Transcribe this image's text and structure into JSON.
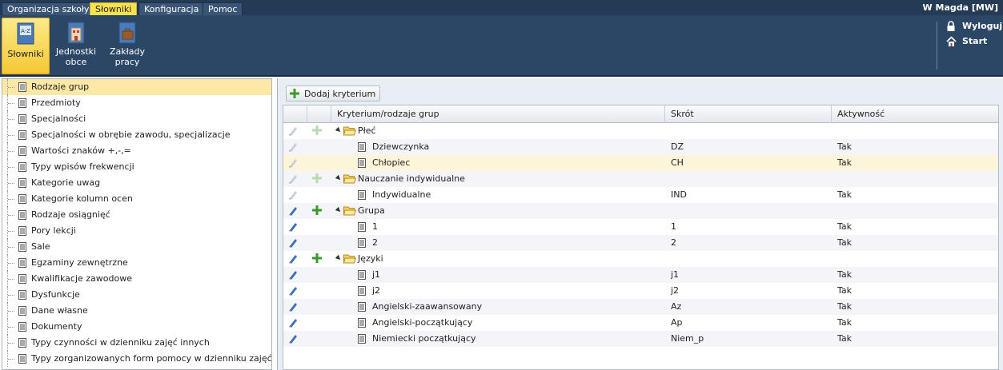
{
  "menu": {
    "tabs": [
      {
        "label": "Organizacja szkoły"
      },
      {
        "label": "Słowniki"
      },
      {
        "label": "Konfiguracja"
      },
      {
        "label": "Pomoc"
      }
    ],
    "user": "W Magda [MW]"
  },
  "ribbon": {
    "buttons": [
      {
        "label": "Słowniki"
      },
      {
        "label": "Jednostki obce"
      },
      {
        "label": "Zakłady pracy"
      }
    ],
    "logout": "Wyloguj",
    "start": "Start"
  },
  "tree": {
    "items": [
      {
        "label": "Rodzaje grup"
      },
      {
        "label": "Przedmioty"
      },
      {
        "label": "Specjalności"
      },
      {
        "label": "Specjalności w obrębie zawodu, specjalizacje"
      },
      {
        "label": "Wartości znaków +,-,="
      },
      {
        "label": "Typy wpisów frekwencji"
      },
      {
        "label": "Kategorie uwag"
      },
      {
        "label": "Kategorie kolumn ocen"
      },
      {
        "label": "Rodzaje osiągnięć"
      },
      {
        "label": "Pory lekcji"
      },
      {
        "label": "Sale"
      },
      {
        "label": "Egzaminy zewnętrzne"
      },
      {
        "label": "Kwalifikacje zawodowe"
      },
      {
        "label": "Dysfunkcje"
      },
      {
        "label": "Dane własne"
      },
      {
        "label": "Dokumenty"
      },
      {
        "label": "Typy czynności w dzienniku zajęć innych"
      },
      {
        "label": "Typy zorganizowanych form pomocy w dzienniku zajęć innych"
      }
    ]
  },
  "toolbar": {
    "add_label": "Dodaj kryterium"
  },
  "grid": {
    "headers": {
      "name": "Kryterium/rodzaje grup",
      "abbr": "Skrót",
      "active": "Aktywność"
    },
    "rows": [
      {
        "name": "Płeć",
        "abbr": "",
        "active": ""
      },
      {
        "name": "Dziewczynka",
        "abbr": "DZ",
        "active": "Tak"
      },
      {
        "name": "Chłopiec",
        "abbr": "CH",
        "active": "Tak"
      },
      {
        "name": "Nauczanie indywidualne",
        "abbr": "",
        "active": ""
      },
      {
        "name": "Indywidualne",
        "abbr": "IND",
        "active": "Tak"
      },
      {
        "name": "Grupa",
        "abbr": "",
        "active": ""
      },
      {
        "name": "1",
        "abbr": "1",
        "active": "Tak"
      },
      {
        "name": "2",
        "abbr": "2",
        "active": "Tak"
      },
      {
        "name": "Języki",
        "abbr": "",
        "active": ""
      },
      {
        "name": "j1",
        "abbr": "j1",
        "active": "Tak"
      },
      {
        "name": "j2",
        "abbr": "j2",
        "active": "Tak"
      },
      {
        "name": "Angielski-zaawansowany",
        "abbr": "Az",
        "active": "Tak"
      },
      {
        "name": "Angielski-początkujący",
        "abbr": "Ap",
        "active": "Tak"
      },
      {
        "name": "Niemiecki początkujący",
        "abbr": "Niem_p",
        "active": "Tak"
      }
    ]
  }
}
